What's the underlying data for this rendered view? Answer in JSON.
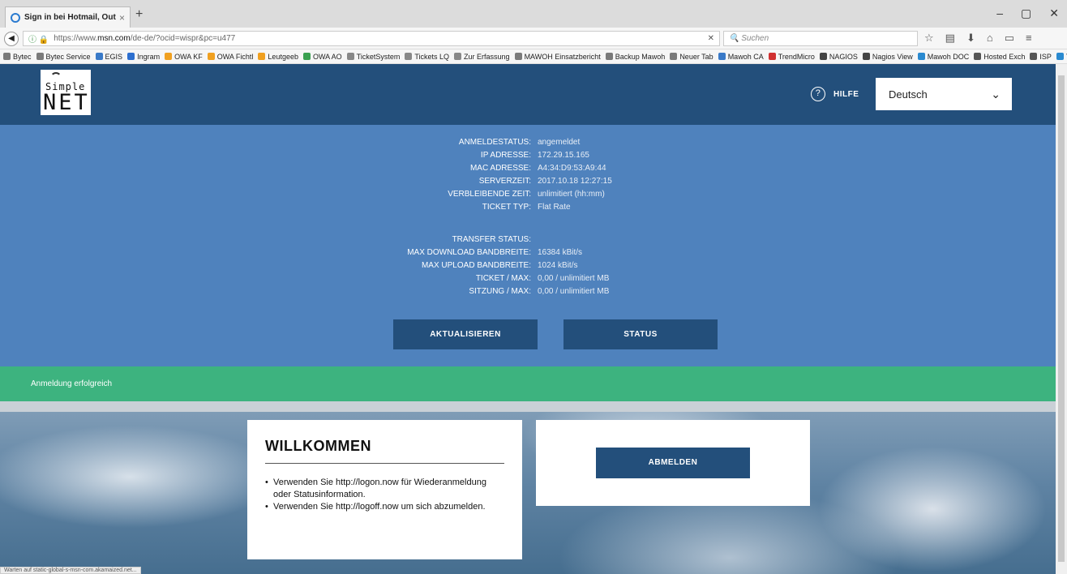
{
  "browser": {
    "tab_title": "Sign in bei Hotmail, Outl...",
    "tab_close": "×",
    "new_tab": "+",
    "window_controls": [
      "–",
      "▢",
      "✕"
    ],
    "back": "◀",
    "lock": "ⓘ 🔒",
    "url_prefix": "https://www.",
    "url_host": "msn.com",
    "url_rest": "/de-de/?ocid=wispr&pc=u477",
    "url_clear": "✕",
    "search_placeholder": "🔍 Suchen",
    "nav_icons": [
      "☆",
      "▤",
      "⬇",
      "⌂",
      "▭",
      "≡"
    ],
    "bookmarks": [
      {
        "label": "Bytec",
        "color": "#7a7a7a"
      },
      {
        "label": "Bytec Service",
        "color": "#7a7a7a"
      },
      {
        "label": "EGIS",
        "color": "#3a7ac8"
      },
      {
        "label": "Ingram",
        "color": "#2d6fcf"
      },
      {
        "label": "OWA KF",
        "color": "#f0a020"
      },
      {
        "label": "OWA Fichtl",
        "color": "#f0a020"
      },
      {
        "label": "Leutgeeb",
        "color": "#f0a020"
      },
      {
        "label": "OWA AO",
        "color": "#3aa050"
      },
      {
        "label": "TicketSystem",
        "color": "#888888"
      },
      {
        "label": "Tickets LQ",
        "color": "#888888"
      },
      {
        "label": "Zur Erfassung",
        "color": "#888888"
      },
      {
        "label": "MAWOH Einsatzbericht",
        "color": "#7a7a7a"
      },
      {
        "label": "Backup Mawoh",
        "color": "#7a7a7a"
      },
      {
        "label": "Neuer Tab",
        "color": "#7a7a7a"
      },
      {
        "label": "Mawoh CA",
        "color": "#3a7ac8"
      },
      {
        "label": "TrendMicro",
        "color": "#d03030"
      },
      {
        "label": "NAGIOS",
        "color": "#444444"
      },
      {
        "label": "Nagios View",
        "color": "#444444"
      },
      {
        "label": "Mawoh DOC",
        "color": "#2a8ad0"
      },
      {
        "label": "Hosted Exch",
        "color": "#555555"
      },
      {
        "label": "ISP",
        "color": "#555555"
      },
      {
        "label": "TV Login",
        "color": "#2a8ad0"
      }
    ],
    "overflow": "»",
    "status_line": "Warten auf static-global-s-msn-com.akamaized.net..."
  },
  "header": {
    "logo_line1": "Simple",
    "logo_line2": "NET",
    "help_icon": "?",
    "help_label": "HILFE",
    "language_selected": "Deutsch",
    "language_chevron": "⌄"
  },
  "status": {
    "rows": [
      {
        "label": "ANMELDESTATUS:",
        "value": "angemeldet"
      },
      {
        "label": "IP ADRESSE:",
        "value": "172.29.15.165"
      },
      {
        "label": "MAC ADRESSE:",
        "value": "A4:34:D9:53:A9:44"
      },
      {
        "label": "SERVERZEIT:",
        "value": "2017.10.18 12:27:15"
      },
      {
        "label": "VERBLEIBENDE ZEIT:",
        "value": "unlimitiert (hh:mm)"
      },
      {
        "label": "TICKET TYP:",
        "value": "Flat Rate"
      },
      {
        "label": "TRANSFER STATUS:",
        "value": ""
      },
      {
        "label": "MAX DOWNLOAD BANDBREITE:",
        "value": "16384 kBit/s"
      },
      {
        "label": "MAX UPLOAD BANDBREITE:",
        "value": "1024 kBit/s"
      },
      {
        "label": "TICKET / MAX:",
        "value": "0,00 / unlimitiert MB"
      },
      {
        "label": "SITZUNG / MAX:",
        "value": "0,00 / unlimitiert MB"
      }
    ],
    "refresh_button": "AKTUALISIEREN",
    "status_button": "STATUS"
  },
  "success_message": "Anmeldung erfolgreich",
  "welcome": {
    "title": "WILLKOMMEN",
    "items": [
      "Verwenden Sie http://logon.now für Wiederanmeldung oder Statusinformation.",
      "Verwenden Sie http://logoff.now um sich abzumelden."
    ]
  },
  "logout_button": "ABMELDEN",
  "colors": {
    "header": "#234f7b",
    "panel": "#4f82bd",
    "success": "#3db37f",
    "button": "#234f7b"
  }
}
